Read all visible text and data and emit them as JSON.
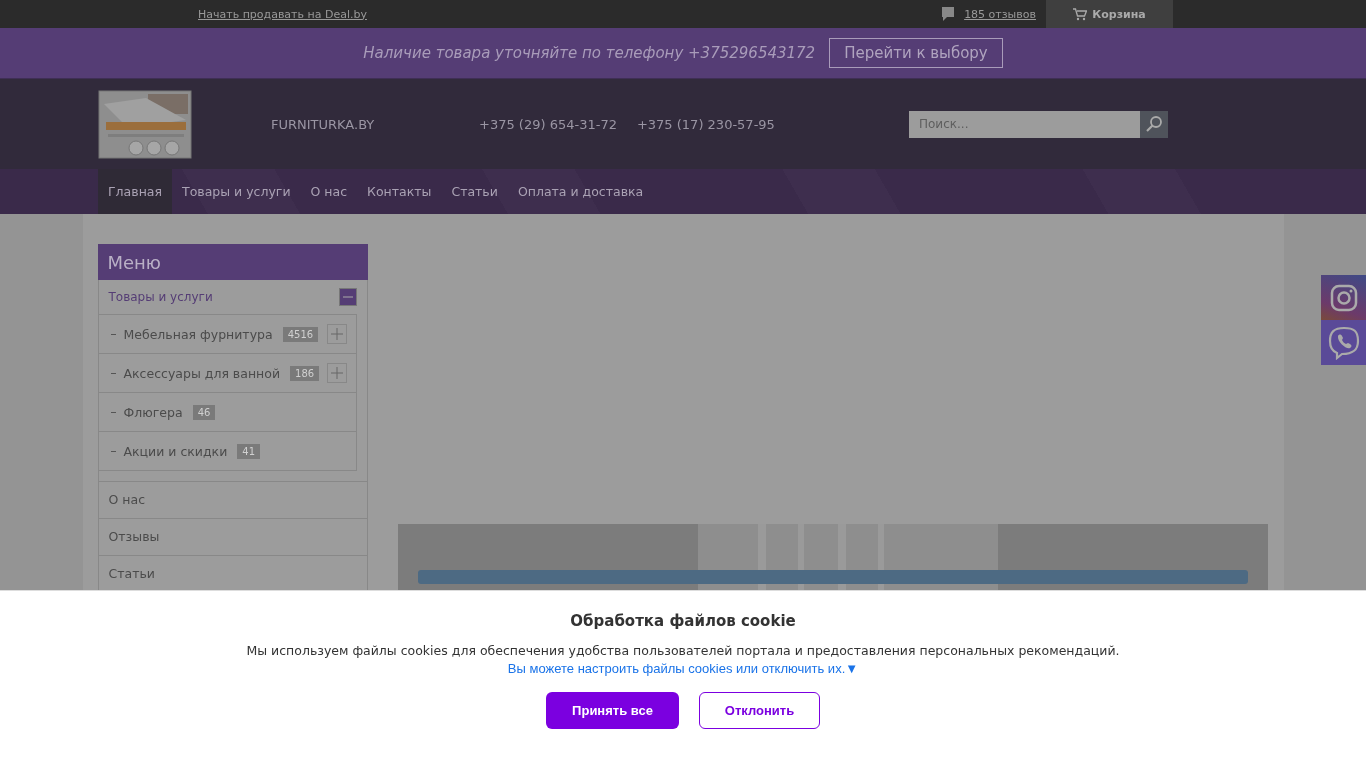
{
  "top_bar": {
    "sell_link": "Начать продавать на Deal.by",
    "reviews_link": "185 отзывов",
    "cart": "Корзина"
  },
  "notice_bar": {
    "text": "Наличие товара уточняйте по телефону +375296543172",
    "button": "Перейти к выбору"
  },
  "header": {
    "site_name": "FURNITURKA.BY",
    "phones": [
      "+375 (29) 654-31-72",
      "+375 (17) 230-57-95"
    ],
    "search": {
      "placeholder": "Поиск..."
    }
  },
  "nav": [
    {
      "label": "Главная",
      "selected": true
    },
    {
      "label": "Товары и услуги",
      "selected": false
    },
    {
      "label": "О нас",
      "selected": false
    },
    {
      "label": "Контакты",
      "selected": false
    },
    {
      "label": "Статьи",
      "selected": false
    },
    {
      "label": "Оплата и доставка",
      "selected": false
    }
  ],
  "sidebar": {
    "title": "Меню",
    "items": [
      {
        "label": "Товары и услуги",
        "expanded": true,
        "children": [
          {
            "label": "Мебельная фурнитура",
            "count": "4516",
            "expandable": true
          },
          {
            "label": "Аксессуары для ванной",
            "count": "186",
            "expandable": true
          },
          {
            "label": "Флюгера",
            "count": "46",
            "expandable": false
          },
          {
            "label": "Акции и скидки",
            "count": "41",
            "expandable": false
          }
        ]
      },
      {
        "label": "О нас"
      },
      {
        "label": "Отзывы"
      },
      {
        "label": "Статьи"
      }
    ]
  },
  "cookie_dialog": {
    "title": "Обработка файлов cookie",
    "text": "Мы используем файлы cookies для обеспечения удобства пользователей портала и предоставления персональных рекомендаций.",
    "settings_link": "Вы можете настроить файлы cookies или отключить их.▼",
    "accept_button": "Принять все",
    "decline_button": "Отклонить"
  }
}
